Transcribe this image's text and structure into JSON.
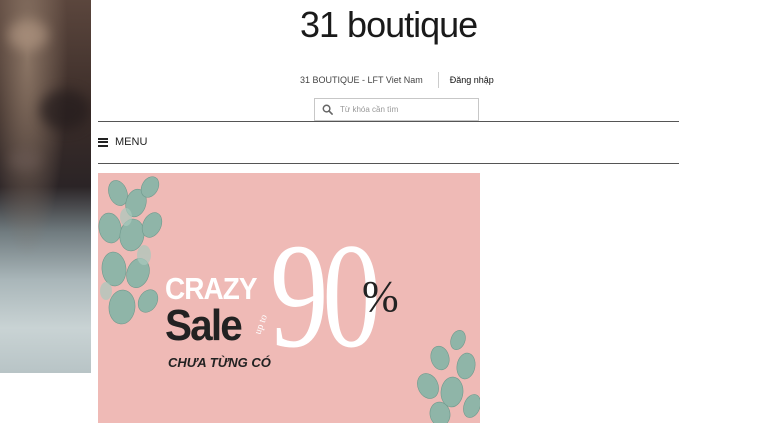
{
  "header": {
    "logo_text": "31 boutique",
    "store_link": "31 BOUTIQUE - LFT Viet Nam",
    "login_link": "Đăng nhập"
  },
  "search": {
    "placeholder": "Từ khóa cần tìm",
    "icon": "search-icon"
  },
  "nav": {
    "menu_label": "MENU",
    "menu_icon": "hamburger-icon"
  },
  "banner": {
    "crazy": "CRAZY",
    "sale": "Sale",
    "up_to": "up to",
    "percent_value": "90",
    "percent_sign": "%",
    "tagline": "CHƯA TỪNG CÓ",
    "background_color": "#efbab6"
  },
  "colors": {
    "text_dark": "#222222",
    "divider": "#555555",
    "banner_pink": "#efbab6"
  }
}
